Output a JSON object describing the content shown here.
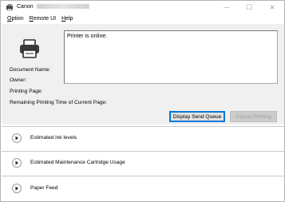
{
  "window": {
    "title": "Canon",
    "minimize_glyph": "—",
    "maximize_glyph": "☐",
    "close_glyph": "✕"
  },
  "menu": [
    {
      "mnemonic": "O",
      "rest": "ption"
    },
    {
      "mnemonic": "R",
      "rest": "emote UI"
    },
    {
      "mnemonic": "H",
      "rest": "elp"
    }
  ],
  "status": {
    "message": "Printer is online."
  },
  "fields": {
    "document_name": "Document Name:",
    "owner": "Owner:",
    "printing_page": "Printing Page:",
    "remaining_time": "Remaining Printing Time of Current Page:"
  },
  "buttons": {
    "display_send_queue": "Display Send Queue",
    "cancel_printing": "Cancel Printing"
  },
  "sections": [
    {
      "label": "Estimated ink levels"
    },
    {
      "label": "Estimated Maintenance Cartridge Usage"
    },
    {
      "label": "Paper Feed"
    }
  ],
  "icons": {
    "app": "canon-printer-app-icon",
    "printer": "printer-icon",
    "expand": "play-triangle-icon"
  },
  "colors": {
    "panel_background": "#f0f0f0",
    "primary_button_border": "#0078d7",
    "disabled_text": "#a0a0a0"
  }
}
